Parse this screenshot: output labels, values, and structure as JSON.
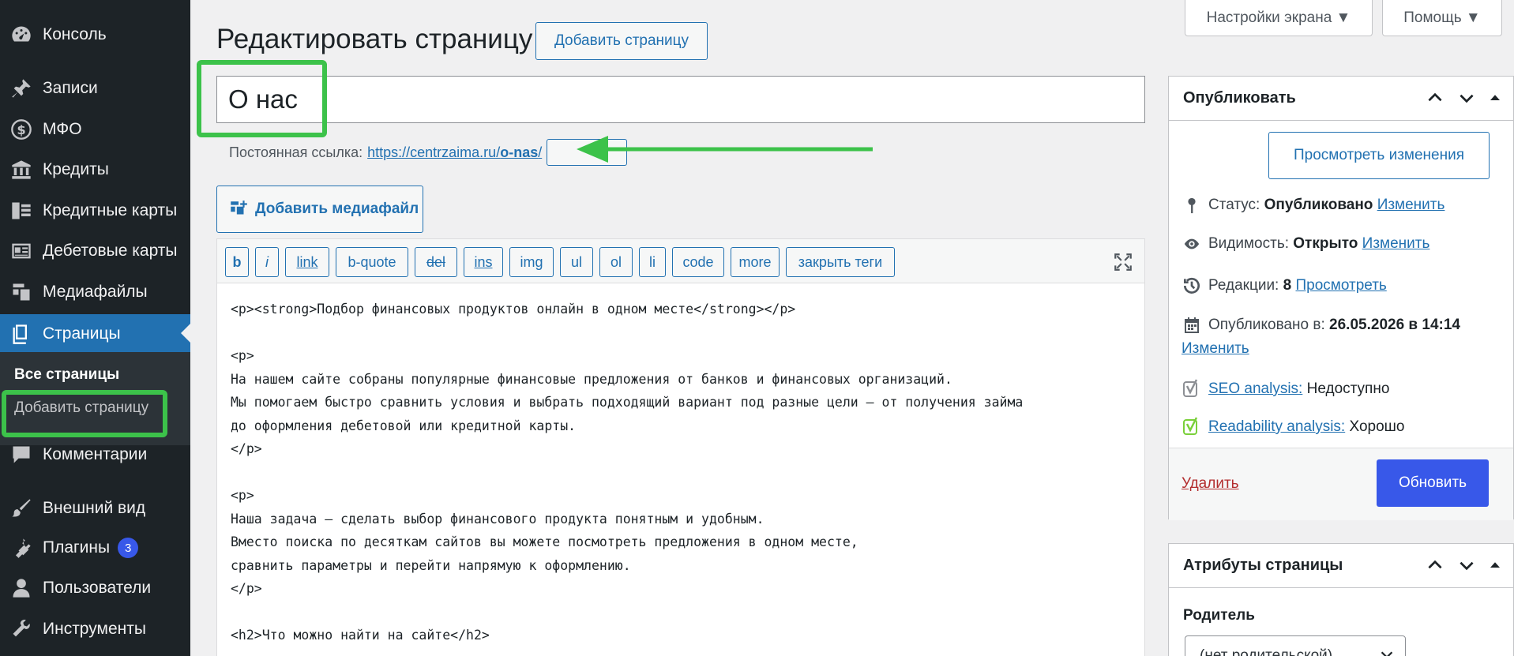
{
  "sidebar": {
    "items": [
      {
        "label": "Консоль",
        "icon": "dashboard-icon"
      },
      {
        "label": "Записи",
        "icon": "pin-icon"
      },
      {
        "label": "МФО",
        "icon": "dollar-icon"
      },
      {
        "label": "Кредиты",
        "icon": "bank-icon"
      },
      {
        "label": "Кредитные карты",
        "icon": "cards-icon"
      },
      {
        "label": "Дебетовые карты",
        "icon": "id-card-icon"
      },
      {
        "label": "Медиафайлы",
        "icon": "media-icon"
      },
      {
        "label": "Страницы",
        "icon": "pages-icon"
      },
      {
        "label": "Комментарии",
        "icon": "comment-icon"
      },
      {
        "label": "Внешний вид",
        "icon": "brush-icon"
      },
      {
        "label": "Плагины",
        "icon": "plugin-icon",
        "badge": "3"
      },
      {
        "label": "Пользователи",
        "icon": "user-icon"
      },
      {
        "label": "Инструменты",
        "icon": "wrench-icon"
      }
    ],
    "submenu": {
      "all_pages": "Все страницы",
      "add_page": "Добавить страницу"
    }
  },
  "top": {
    "screen_options": "Настройки экрана ▼",
    "help": "Помощь ▼"
  },
  "header": {
    "title": "Редактировать страницу",
    "add_new": "Добавить страницу"
  },
  "post": {
    "title": "О нас",
    "permalink_label": "Постоянная ссылка:",
    "permalink_base": "https://centrzaima.ru/",
    "permalink_slug": "o-nas",
    "permalink_tail": "/"
  },
  "editor": {
    "add_media": "Добавить медиафайл",
    "buttons": [
      "b",
      "i",
      "link",
      "b-quote",
      "del",
      "ins",
      "img",
      "ul",
      "ol",
      "li",
      "code",
      "more",
      "закрыть теги"
    ],
    "content": "<p><strong>Подбор финансовых продуктов онлайн в одном месте</strong></p>\n\n<p>\nНа нашем сайте собраны популярные финансовые предложения от банков и финансовых организаций.\nМы помогаем быстро сравнить условия и выбрать подходящий вариант под разные цели — от получения займа\nдо оформления дебетовой или кредитной карты.\n</p>\n\n<p>\nНаша задача — сделать выбор финансового продукта понятным и удобным.\nВместо поиска по десяткам сайтов вы можете посмотреть предложения в одном месте,\nсравнить параметры и перейти напрямую к оформлению.\n</p>\n\n<h2>Что можно найти на сайте</h2>"
  },
  "publish": {
    "title": "Опубликовать",
    "preview": "Просмотреть изменения",
    "status_label": "Статус:",
    "status_value": "Опубликовано",
    "status_edit": "Изменить",
    "visibility_label": "Видимость:",
    "visibility_value": "Открыто",
    "visibility_edit": "Изменить",
    "revisions_label": "Редакции:",
    "revisions_value": "8",
    "revisions_link": "Просмотреть",
    "published_label": "Опубликовано в:",
    "published_value": "26.05.2026 в 14:14",
    "published_edit": "Изменить",
    "seo_link": "SEO analysis:",
    "seo_value": "Недоступно",
    "readability_link": "Readability analysis:",
    "readability_value": "Хорошо",
    "delete": "Удалить",
    "update": "Обновить"
  },
  "attributes": {
    "title": "Атрибуты страницы",
    "parent_label": "Родитель",
    "parent_value": "(нет родительской)"
  },
  "colors": {
    "sidebar_bg": "#1d2327",
    "accent": "#2271b1",
    "primary_button": "#3858e9",
    "highlight": "#3cc24a"
  }
}
